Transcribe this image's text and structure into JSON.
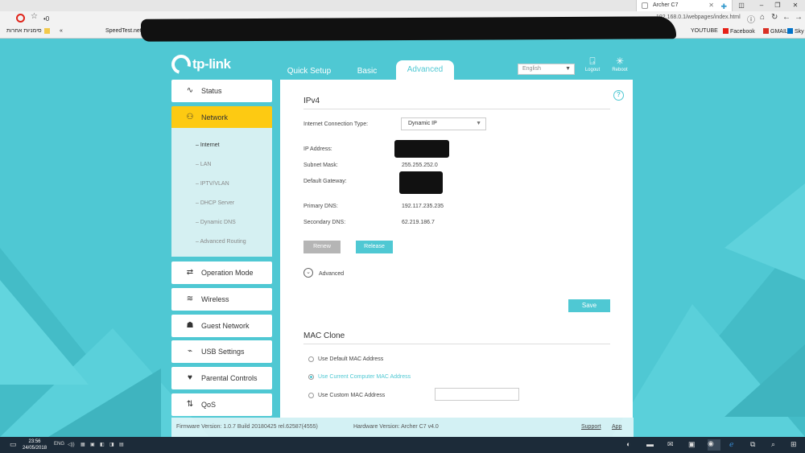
{
  "browser": {
    "tab_title": "Archer C7",
    "url": "192.168.0.1/webpages/index.html",
    "url_prefix": "•0",
    "bookmarks_left": [
      {
        "label": "סימניות אחרות",
        "icon": "folder-icon"
      },
      {
        "label": "«",
        "icon": ""
      },
      {
        "label": "SpeedTest.net",
        "icon": ""
      }
    ],
    "bookmarks_right": [
      {
        "label": "YOUTUBE",
        "icon": "youtube-icon",
        "color": "#e62117"
      },
      {
        "label": "Facebook",
        "icon": "facebook-icon",
        "color": "#3b5998"
      },
      {
        "label": "GMAIL",
        "icon": "gmail-icon",
        "color": "#d93025"
      },
      {
        "label": "Sky",
        "icon": "sky-icon",
        "color": "#0072c9"
      }
    ]
  },
  "header": {
    "logo_text": "tp-link",
    "tabs": [
      {
        "label": "Quick Setup",
        "active": false
      },
      {
        "label": "Basic",
        "active": false
      },
      {
        "label": "Advanced",
        "active": true
      }
    ],
    "language": "English",
    "logout_label": "Logout",
    "reboot_label": "Reboot"
  },
  "sidebar": {
    "items": [
      {
        "label": "Status",
        "icon": "pulse-icon",
        "active": false
      },
      {
        "label": "Network",
        "icon": "network-icon",
        "active": true
      },
      {
        "label": "Operation Mode",
        "icon": "operation-mode-icon",
        "active": false
      },
      {
        "label": "Wireless",
        "icon": "wireless-icon",
        "active": false
      },
      {
        "label": "Guest Network",
        "icon": "guest-network-icon",
        "active": false
      },
      {
        "label": "USB Settings",
        "icon": "usb-icon",
        "active": false
      },
      {
        "label": "Parental Controls",
        "icon": "parental-controls-icon",
        "active": false
      },
      {
        "label": "QoS",
        "icon": "qos-icon",
        "active": false
      }
    ],
    "subitems": [
      {
        "label": "– Internet",
        "active": true
      },
      {
        "label": "– LAN",
        "active": false
      },
      {
        "label": "– IPTV/VLAN",
        "active": false
      },
      {
        "label": "– DHCP Server",
        "active": false
      },
      {
        "label": "– Dynamic DNS",
        "active": false
      },
      {
        "label": "– Advanced Routing",
        "active": false
      }
    ]
  },
  "ipv4": {
    "title": "IPv4",
    "conn_type_label": "Internet Connection Type:",
    "conn_type_value": "Dynamic IP",
    "ip_label": "IP Address:",
    "subnet_label": "Subnet Mask:",
    "subnet_value": "255.255.252.0",
    "gateway_label": "Default Gateway:",
    "primary_dns_label": "Primary DNS:",
    "primary_dns_value": "192.117.235.235",
    "secondary_dns_label": "Secondary DNS:",
    "secondary_dns_value": "62.219.186.7",
    "renew_label": "Renew",
    "release_label": "Release",
    "advanced_label": "Advanced",
    "save_label": "Save"
  },
  "mac_clone": {
    "title": "MAC Clone",
    "options": [
      {
        "label": "Use Default MAC Address",
        "selected": false
      },
      {
        "label": "Use Current Computer MAC Address",
        "selected": true
      },
      {
        "label": "Use Custom MAC Address",
        "selected": false
      }
    ]
  },
  "footer": {
    "firmware": "Firmware Version: 1.0.7 Build 20180425 rel.62587(4555)",
    "hardware": "Hardware Version: Archer C7 v4.0",
    "support": "Support",
    "app": "App"
  },
  "taskbar": {
    "time": "23:56",
    "date": "24/05/2018",
    "lang": "ENG"
  },
  "colors": {
    "accent": "#4fc8d3",
    "active_nav": "#fdca12",
    "renew_button": "#b5b5b5"
  }
}
